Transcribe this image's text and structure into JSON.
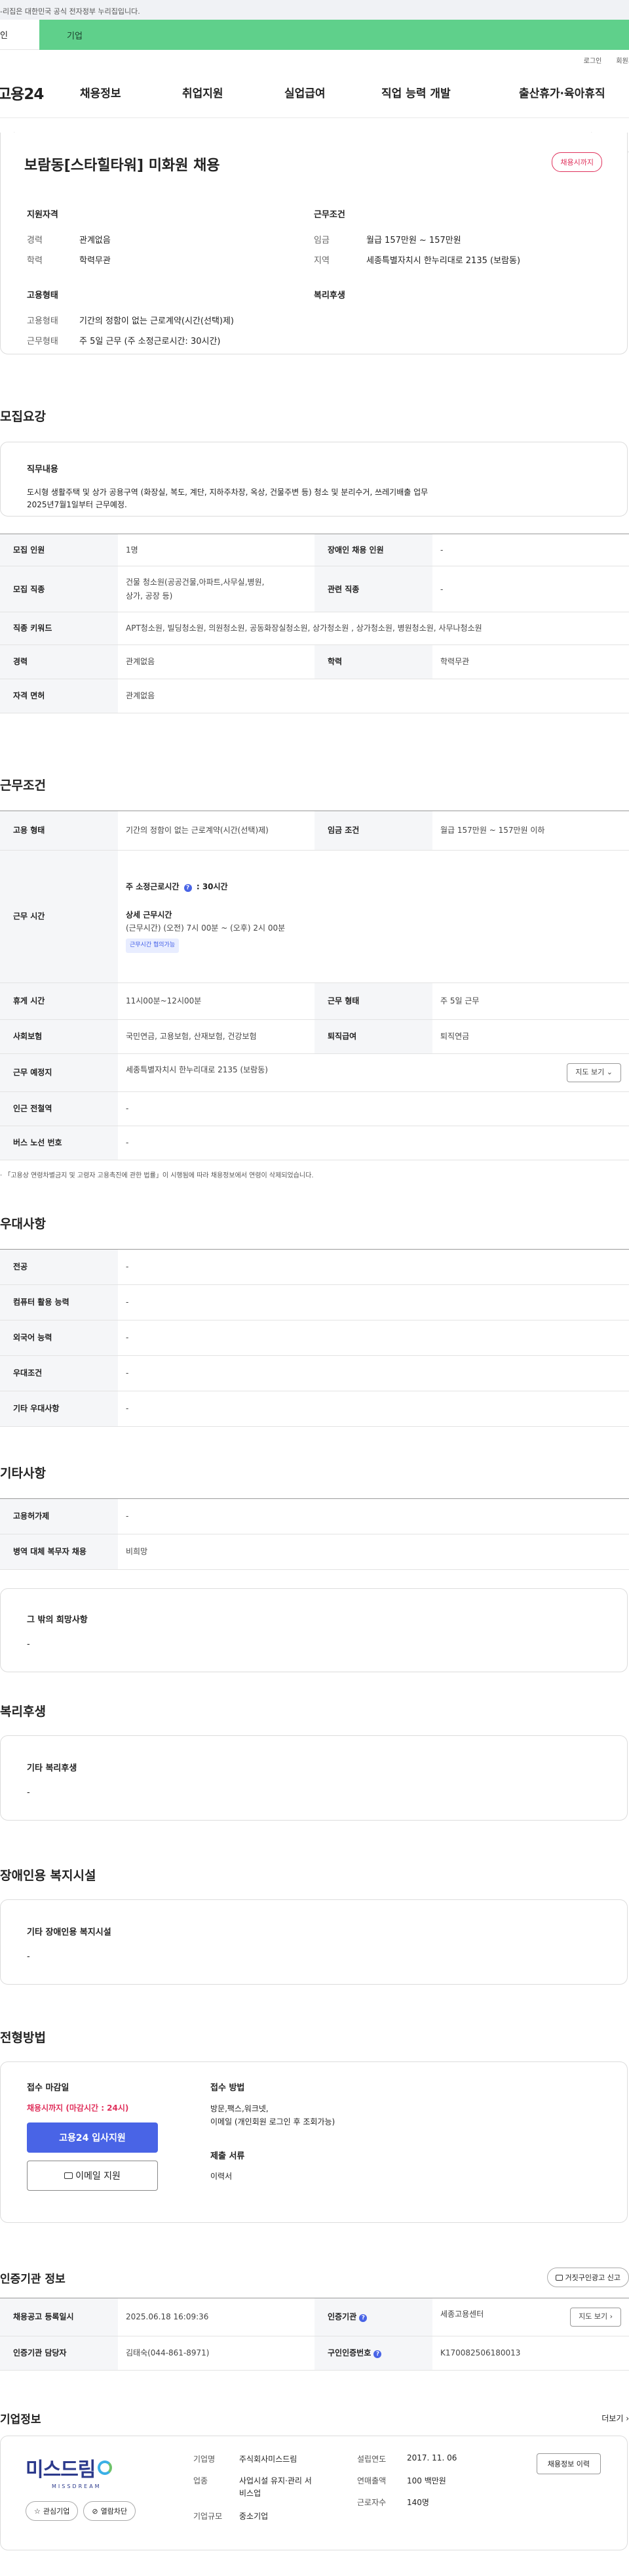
{
  "banner": {
    "text": "-리집은 대한민국 공식 전자정부 누리집입니다."
  },
  "top_tabs": {
    "individual": "인",
    "corp": "기업"
  },
  "util": {
    "login": "로그인",
    "join": "회원가"
  },
  "gnb": {
    "logo": "고용24",
    "items": [
      "채용정보",
      "취업지원",
      "실업급여",
      "직업 능력 개발",
      "출산휴가·육아휴직"
    ]
  },
  "subnav": [
    "모집요강",
    "근무조건",
    "우대사항",
    "복리후생",
    "전형방법",
    "기업정보"
  ],
  "summary": {
    "title": "보람동[스타힐타워] 미화원 채용",
    "badge": "채용시까지",
    "qual_head": "지원자격",
    "qual": [
      {
        "k": "경력",
        "v": "관계없음"
      },
      {
        "k": "학력",
        "v": "학력무관"
      }
    ],
    "work_head": "근무조건",
    "work": [
      {
        "k": "임금",
        "v": "월급 157만원 ~ 157만원"
      },
      {
        "k": "지역",
        "v": "세종특별자치시 한누리대로 2135 (보람동)"
      }
    ],
    "emp_head": "고용형태",
    "emp": [
      {
        "k": "고용형태",
        "v": "기간의 정함이 없는 근로계약(시간(선택)제)"
      },
      {
        "k": "근무형태",
        "v": "주 5일 근무 (주 소정근로시간: 30시간)"
      }
    ],
    "welfare_head": "복리후생"
  },
  "recruit": {
    "title": "모집요강",
    "duty_head": "직무내용",
    "duty_text": "도시형 생활주택 및 상가 공용구역 (화장실, 복도, 계단, 지하주차장, 옥상, 건물주변 등) 청소 및 분리수거, 쓰레기배출 업무",
    "duty_text2": "2025년7월1일부터 근무예정.",
    "rows": {
      "count_h": "모집 인원",
      "count_v": "1명",
      "disabled_h": "장애인 채용 인원",
      "disabled_v": "-",
      "job_h": "모집 직종",
      "job_v": "건물 청소원(공공건물,아파트,사무실,병원,",
      "job_v2": "상가, 공장 등)",
      "rel_h": "관련 직종",
      "rel_v": "-",
      "kw_h": "직종 키워드",
      "kw_v": "APT청소원, 빌딩청소원, 의원청소원, 공동화장실청소원, 상가청소원 , 상가청소원, 병원청소원, 사무나청소원",
      "career_h": "경력",
      "career_v": "관계없음",
      "edu_h": "학력",
      "edu_v": "학력무관",
      "lic_h": "자격 면허",
      "lic_v": "관계없음"
    }
  },
  "conditions": {
    "title": "근무조건",
    "emp_h": "고용 형태",
    "emp_v": "기간의 정함이 없는 근로계약(시간(선택)제)",
    "wage_h": "임금 조건",
    "wage_v": "월급 157만원 ~ 157만원 이하",
    "time_h": "근무 시간",
    "time_main": "주 소정근로시간",
    "time_main_v": "30시간",
    "time_detail_h": "상세 근무시간",
    "time_detail": "(근무시간) (오전) 7시 00분 ~ (오후) 2시 00분",
    "time_tag": "근무시간 협의가능",
    "rest_h": "휴게 시간",
    "rest_v": "11시00분~12시00분",
    "form_h": "근무 형태",
    "form_v": "주 5일 근무",
    "ins_h": "사회보험",
    "ins_v": "국민연금, 고용보험, 산재보험, 건강보험",
    "sev_h": "퇴직급여",
    "sev_v": "퇴직연금",
    "place_h": "근무 예정지",
    "place_v": "세종특별자치시 한누리대로 2135 (보람동)",
    "map_btn": "지도 보기",
    "subway_h": "인근 전철역",
    "subway_v": "-",
    "bus_h": "버스 노선 번호",
    "bus_v": "-",
    "note": "「고용상 연령차별금지 및 고령자 고용촉진에 관한 법률」이 시행됨에 따라 채용정보에서 연령이 삭제되었습니다."
  },
  "pref": {
    "title": "우대사항",
    "rows": [
      {
        "h": "전공",
        "v": "-"
      },
      {
        "h": "컴퓨터 활용 능력",
        "v": "-"
      },
      {
        "h": "외국어 능력",
        "v": "-"
      },
      {
        "h": "우대조건",
        "v": "-"
      },
      {
        "h": "기타 우대사항",
        "v": "-"
      }
    ]
  },
  "etc": {
    "title": "기타사항",
    "rows": [
      {
        "h": "고용허가제",
        "v": "-"
      },
      {
        "h": "병역 대체 복무자 채용",
        "v": "비희망"
      }
    ],
    "box_h": "그 밖의 희망사항",
    "box_v": "-"
  },
  "welfare": {
    "title": "복리후생",
    "box_h": "기타 복리후생",
    "box_v": "-"
  },
  "disabled": {
    "title": "장애인용 복지시설",
    "box_h": "기타 장애인용 복지시설",
    "box_v": "-"
  },
  "process": {
    "title": "전형방법",
    "deadline_h": "접수 마감일",
    "deadline_v": "채용시까지 (마감시간 : 24시)",
    "apply_btn": "고용24 입사지원",
    "email_btn": "이메일 지원",
    "method_h": "접수 방법",
    "method_v1": "방문,팩스,워크넷,",
    "method_v2": "이메일 (개인회원 로그인 후 조회가능)",
    "docs_h": "제출 서류",
    "docs_v": "이력서"
  },
  "agency": {
    "title": "인증기관 정보",
    "report_btn": "거짓구인광고 신고",
    "reg_h": "채용공고 등록일시",
    "reg_v": "2025.06.18 16:09:36",
    "org_h": "인증기관",
    "org_v": "세종고용센터",
    "map_btn": "지도 보기",
    "mgr_h": "인증기관 담당자",
    "mgr_v": "김태숙(044-861-8971)",
    "num_h": "구인인증번호",
    "num_v": "K170082506180013"
  },
  "company": {
    "title": "기업정보",
    "more": "더보기",
    "logo_text": "미스드림",
    "logo_sub": "MISSDREAM",
    "fav_btn": "관심기업",
    "block_btn": "열람차단",
    "info": [
      {
        "k": "기업명",
        "v": "주식회사미스드림"
      },
      {
        "k": "업종",
        "v": "사업시설 유지·관리 서비스업"
      },
      {
        "k": "기업규모",
        "v": "중소기업"
      }
    ],
    "info2": [
      {
        "k": "설립연도",
        "v": "2017. 11. 06"
      },
      {
        "k": "연매출액",
        "v": "100 백만원"
      },
      {
        "k": "근로자수",
        "v": "140명"
      }
    ],
    "jobs_btn": "채용정보 이력"
  }
}
